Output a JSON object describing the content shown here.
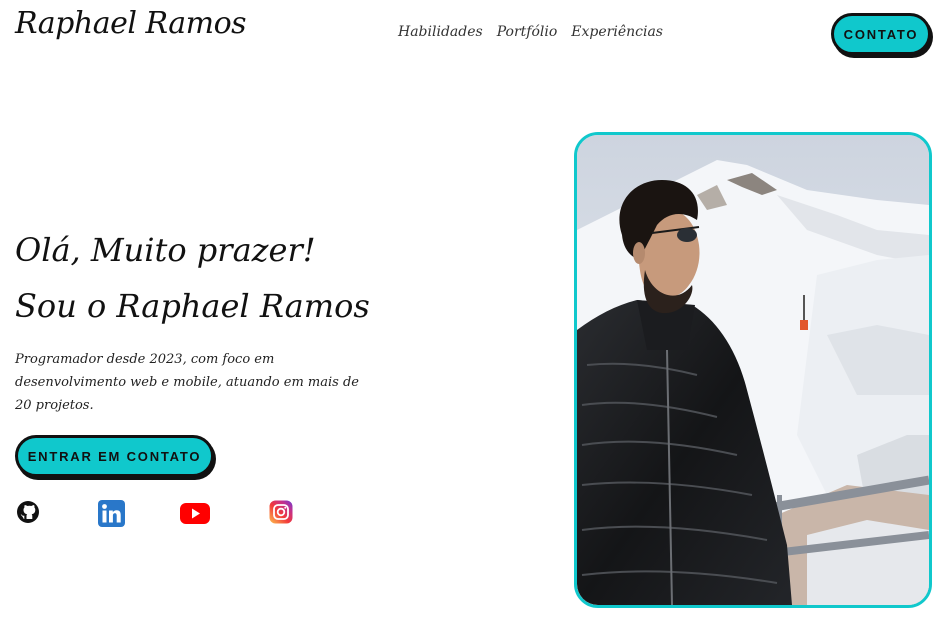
{
  "header": {
    "logo": "Raphael Ramos",
    "nav": [
      {
        "label": "Habilidades"
      },
      {
        "label": "Portfólio"
      },
      {
        "label": "Experiências"
      }
    ],
    "contact_button": "CONTATO"
  },
  "hero": {
    "greeting_line1": "Olá, Muito prazer!",
    "greeting_line2": "Sou o Raphael Ramos",
    "description": "Programador desde 2023, com foco em desenvolvimento web e mobile, atuando em mais de 20 projetos.",
    "cta_button": "ENTRAR EM CONTATO"
  },
  "socials": [
    {
      "icon": "github-icon"
    },
    {
      "icon": "linkedin-icon"
    },
    {
      "icon": "youtube-icon"
    },
    {
      "icon": "instagram-icon"
    }
  ],
  "colors": {
    "accent": "#10c8cc",
    "text": "#111111",
    "background": "#ffffff"
  }
}
